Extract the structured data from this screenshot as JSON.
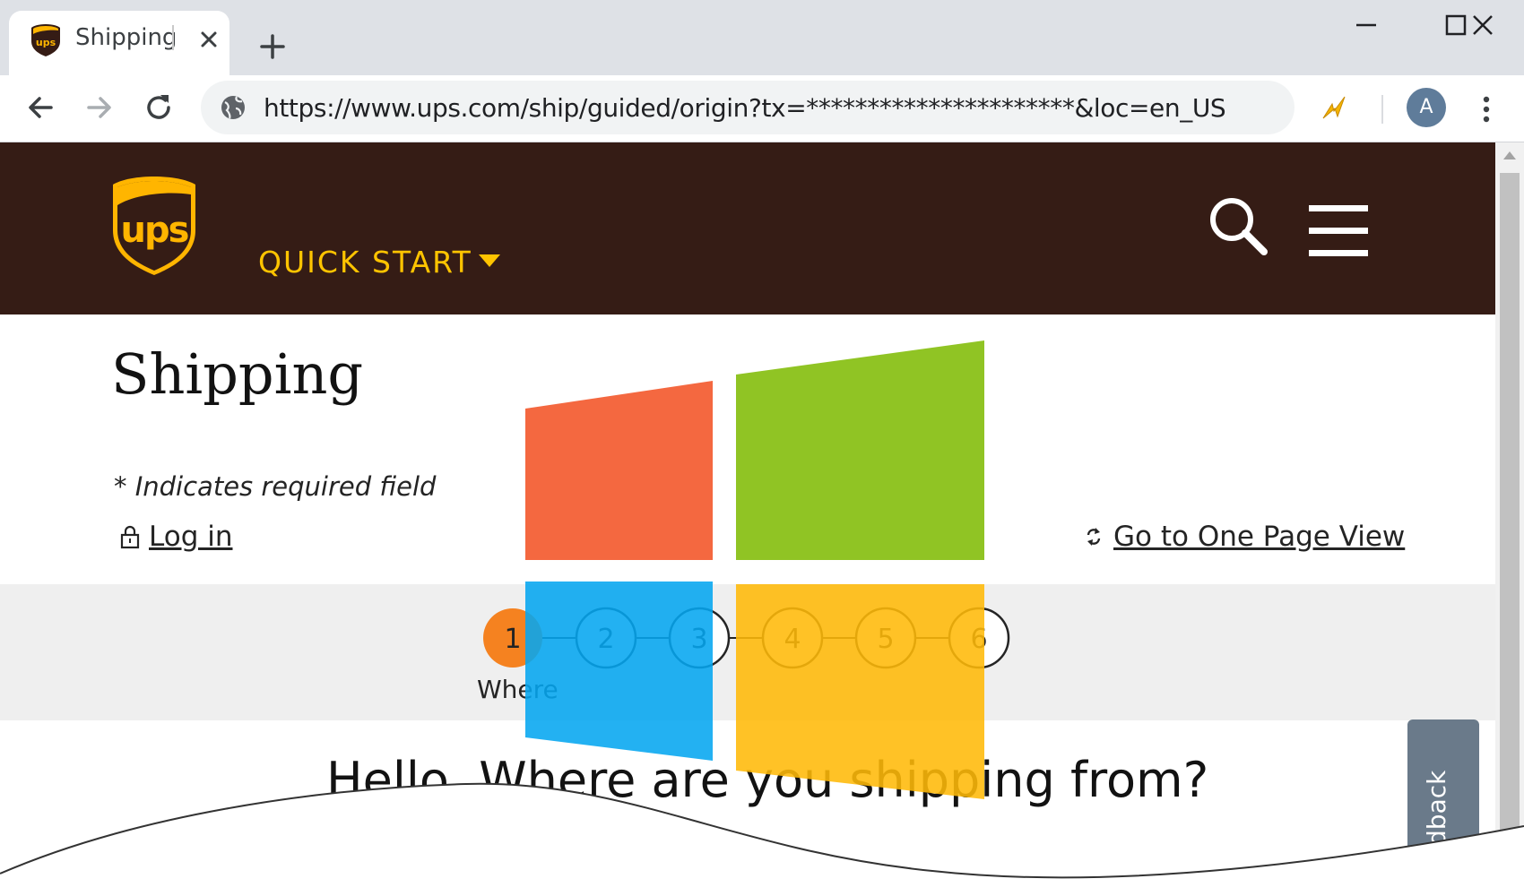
{
  "browser": {
    "tab": {
      "title": "Shipping"
    },
    "address_url": "https://www.ups.com/ship/guided/origin?tx=**********************&loc=en_US",
    "profile_initial": "A"
  },
  "site": {
    "nav": {
      "quick_start_label": "QUICK START"
    }
  },
  "page": {
    "title": "Shipping",
    "required_note": "* Indicates required field",
    "login_label": "Log in",
    "one_page_view_label": "Go to One Page View",
    "steps": [
      {
        "number": "1",
        "active": true
      },
      {
        "number": "2",
        "active": false
      },
      {
        "number": "3",
        "active": false
      },
      {
        "number": "4",
        "active": false
      },
      {
        "number": "5",
        "active": false
      },
      {
        "number": "6",
        "active": false
      }
    ],
    "current_step_label": "Where",
    "question": "Hello. Where are you shipping from?",
    "feedback_label": "Feedback"
  },
  "colors": {
    "header_bg": "#351c15",
    "accent_gold": "#ffc400",
    "step_active": "#f58220",
    "windows_logo": [
      "#f35325",
      "#81bc06",
      "#05a6f0",
      "#ffba08"
    ]
  }
}
